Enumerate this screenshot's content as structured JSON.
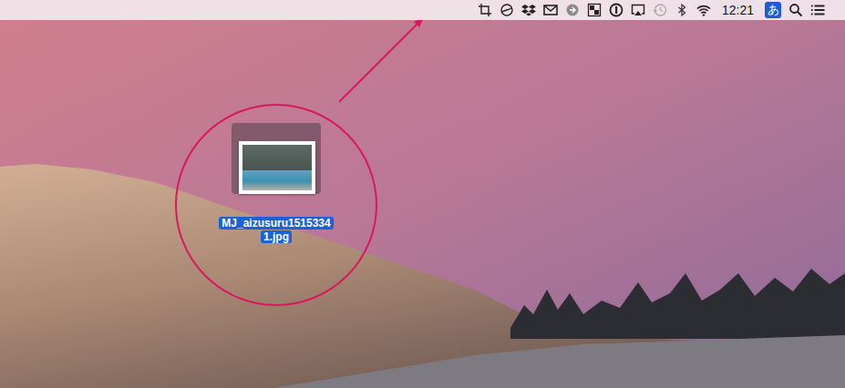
{
  "menu_bar": {
    "clock": "12:21",
    "input_method": "あ"
  },
  "desktop": {
    "file": {
      "name_lines": [
        "MJ_aizusuru1515334",
        "1.jpg"
      ],
      "selected": true
    }
  }
}
